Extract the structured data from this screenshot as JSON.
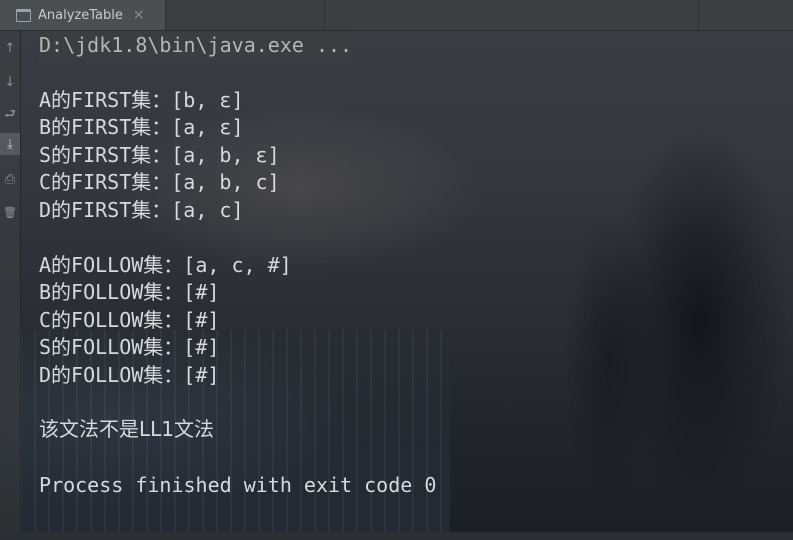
{
  "tab": {
    "label": "AnalyzeTable",
    "close": "×"
  },
  "toolbar": {
    "icons": [
      "up-arrow-icon",
      "down-arrow-icon",
      "soft-wrap-icon",
      "scroll-to-end-icon",
      "print-icon",
      "trash-icon"
    ],
    "glyphs": [
      "↑",
      "↓",
      "⮐",
      "⤓",
      "⎙",
      "🗑"
    ]
  },
  "console": {
    "command": "D:\\jdk1.8\\bin\\java.exe ...",
    "first_sets": [
      "A的FIRST集：[b, ε]",
      "B的FIRST集：[a, ε]",
      "S的FIRST集：[a, b, ε]",
      "C的FIRST集：[a, b, c]",
      "D的FIRST集：[a, c]"
    ],
    "follow_sets": [
      "A的FOLLOW集：[a, c, #]",
      "B的FOLLOW集：[#]",
      "C的FOLLOW集：[#]",
      "S的FOLLOW集：[#]",
      "D的FOLLOW集：[#]"
    ],
    "verdict": "该文法不是LL1文法",
    "exit_message": "Process finished with exit code 0"
  },
  "colors": {
    "text": "#d7d9dc",
    "tab_bg": "#4b4f52",
    "tabbar_bg": "#3c3f41"
  }
}
